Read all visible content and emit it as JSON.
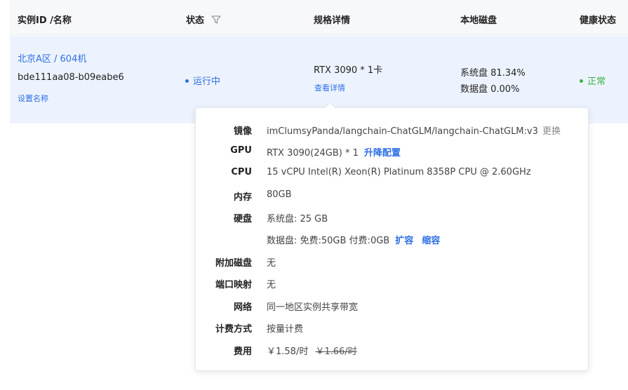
{
  "table": {
    "headers": {
      "instance": "实例ID /名称",
      "status": "状态",
      "spec": "规格详情",
      "disk": "本地磁盘",
      "health": "健康状态"
    }
  },
  "row": {
    "region_machine": "北京A区 / 604机",
    "instance_id": "bde111aa08-b09eabe6",
    "set_name_link": "设置名称",
    "status": "运行中",
    "status_color": "#2f6fe4",
    "spec_text": "RTX 3090 * 1卡",
    "view_details_link": "查看详情",
    "system_disk": "系统盘 81.34%",
    "data_disk": "数据盘 0.00%",
    "health": "正常",
    "health_color": "#3bb54a"
  },
  "popover": {
    "image": {
      "label": "镜像",
      "value": "imClumsyPanda/langchain-ChatGLM/langchain-ChatGLM:v3",
      "action": "更换"
    },
    "gpu": {
      "label": "GPU",
      "value": "RTX 3090(24GB) * 1",
      "action": "升降配置"
    },
    "cpu": {
      "label": "CPU",
      "value": "15 vCPU Intel(R) Xeon(R) Platinum 8358P CPU @ 2.60GHz"
    },
    "memory": {
      "label": "内存",
      "value": "80GB"
    },
    "disk": {
      "label": "硬盘",
      "system": "系统盘:  25 GB",
      "data": "数据盘:  免费:50GB   付费:0GB",
      "expand": "扩容",
      "shrink": "缩容"
    },
    "extra_disk": {
      "label": "附加磁盘",
      "value": "无"
    },
    "port_mapping": {
      "label": "端口映射",
      "value": "无"
    },
    "network": {
      "label": "网络",
      "value": "同一地区实例共享带宽"
    },
    "billing": {
      "label": "计费方式",
      "value": "按量计费"
    },
    "fee": {
      "label": "费用",
      "price": "￥1.58/时",
      "original_price": "￥1.66/时"
    }
  }
}
